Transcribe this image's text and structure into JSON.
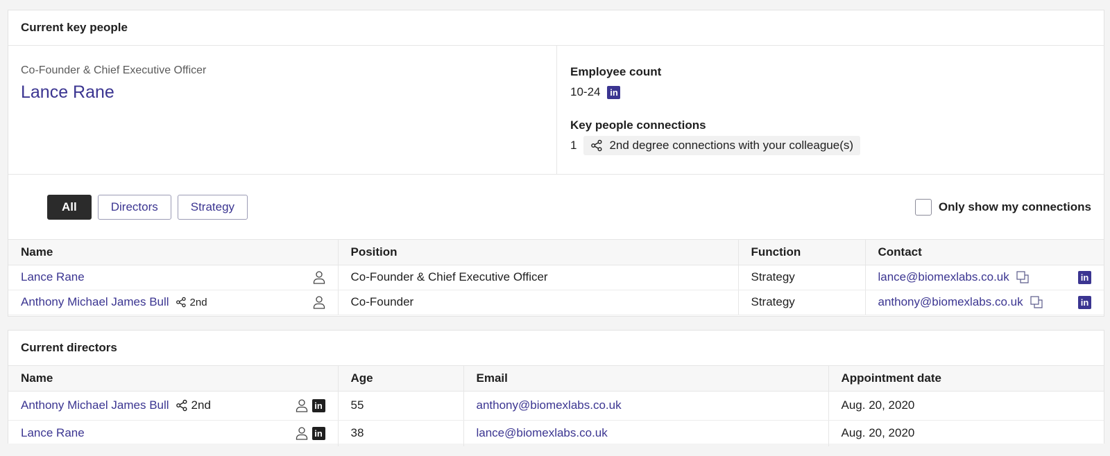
{
  "key_people": {
    "title": "Current key people",
    "ceo_role": "Co-Founder & Chief Executive Officer",
    "ceo_name": "Lance Rane",
    "employee_count_label": "Employee count",
    "employee_count_value": "10-24",
    "connections_label": "Key people connections",
    "connections_count": "1",
    "connections_text": "2nd degree connections with your colleague(s)",
    "filters": [
      "All",
      "Directors",
      "Strategy"
    ],
    "active_filter": "All",
    "only_mine_label": "Only show my connections",
    "columns": [
      "Name",
      "Position",
      "Function",
      "Contact"
    ],
    "rows": [
      {
        "name": "Lance Rane",
        "degree": "",
        "position": "Co-Founder & Chief Executive Officer",
        "function": "Strategy",
        "email": "lance@biomexlabs.co.uk"
      },
      {
        "name": "Anthony Michael James Bull",
        "degree": "2nd",
        "position": "Co-Founder",
        "function": "Strategy",
        "email": "anthony@biomexlabs.co.uk"
      }
    ]
  },
  "directors": {
    "title": "Current directors",
    "columns": [
      "Name",
      "Age",
      "Email",
      "Appointment date"
    ],
    "rows": [
      {
        "name": "Anthony Michael James Bull",
        "degree": "2nd",
        "age": "55",
        "email": "anthony@biomexlabs.co.uk",
        "appointment_date": "Aug. 20, 2020"
      },
      {
        "name": "Lance Rane",
        "degree": "",
        "age": "38",
        "email": "lance@biomexlabs.co.uk",
        "appointment_date": "Aug. 20, 2020"
      }
    ]
  },
  "icons": {
    "linkedin_glyph": "in",
    "person": "person-icon",
    "share": "share-icon",
    "copy": "copy-icon"
  },
  "colors": {
    "link": "#3b3591",
    "active_chip": "#2b2b2b"
  }
}
